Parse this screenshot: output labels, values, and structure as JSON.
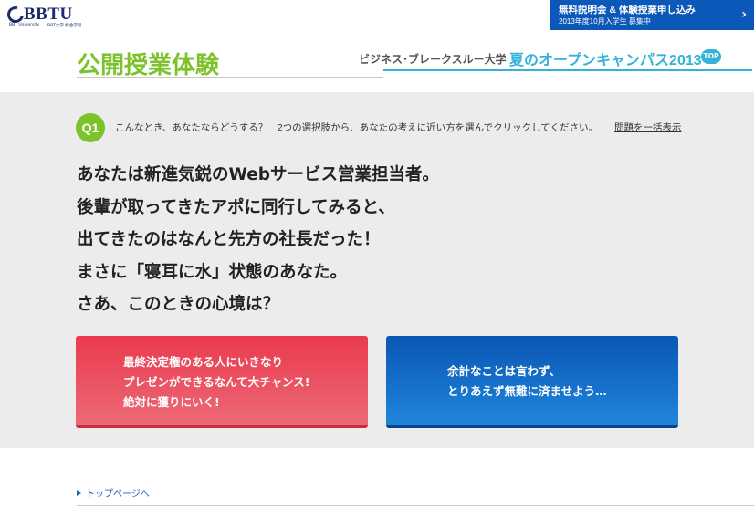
{
  "header": {
    "logo_text": "BBTU",
    "logo_sub_left": "BBT University",
    "logo_sub_right": "BBT大学 総合学習",
    "cta_title": "無料説明会 & 体験授業申し込み",
    "cta_subtitle": "2013年度10月入学生 募集中",
    "cta_arrow": "›",
    "page_title": "公開授業体験",
    "brand": "ビジネス･ブレークスルー大学",
    "campaign": "夏のオープンキャンパス2013",
    "top_badge": "TOP"
  },
  "question": {
    "number": "Q1",
    "instruction": "こんなとき、あなたならどうする？　2つの選択肢から、あなたの考えに近い方を選んでクリックしてください。",
    "show_all_link": "問題を一括表示",
    "lines": [
      "あなたは新進気鋭のWebサービス営業担当者。",
      "後輩が取ってきたアポに同行してみると、",
      "出てきたのはなんと先方の社長だった！",
      "まさに「寝耳に水」状態のあなた。",
      "さあ、このときの心境は？"
    ]
  },
  "choices": {
    "a": [
      "最終決定権のある人にいきなり",
      "プレゼンができるなんて大チャンス!",
      "絶対に獲りにいく!"
    ],
    "b": [
      "余計なことは言わず、",
      "とりあえず無難に済ませよう…"
    ]
  },
  "footer": {
    "top_link": "トップページへ"
  },
  "colors": {
    "brand_green": "#7cc22a",
    "campaign_blue": "#34b2d8",
    "choice_a_red": "#ea3a4d",
    "choice_b_blue": "#0a56b3",
    "cta_blue": "#0c58b8"
  }
}
